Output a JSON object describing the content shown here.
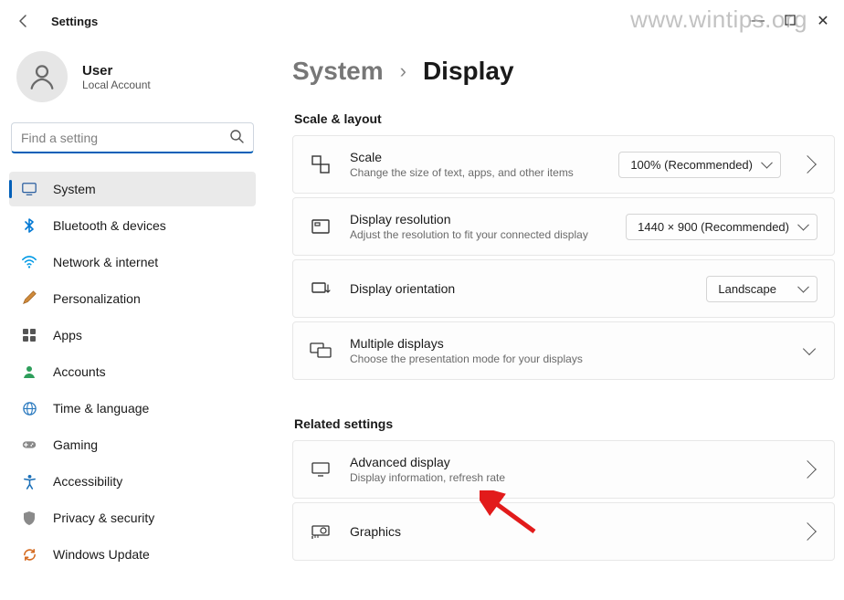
{
  "titlebar": {
    "title": "Settings"
  },
  "watermark": "www.wintips.org",
  "profile": {
    "name": "User",
    "subtitle": "Local Account"
  },
  "search": {
    "placeholder": "Find a setting"
  },
  "sidebar": {
    "items": [
      {
        "label": "System"
      },
      {
        "label": "Bluetooth & devices"
      },
      {
        "label": "Network & internet"
      },
      {
        "label": "Personalization"
      },
      {
        "label": "Apps"
      },
      {
        "label": "Accounts"
      },
      {
        "label": "Time & language"
      },
      {
        "label": "Gaming"
      },
      {
        "label": "Accessibility"
      },
      {
        "label": "Privacy & security"
      },
      {
        "label": "Windows Update"
      }
    ]
  },
  "breadcrumb": {
    "parent": "System",
    "current": "Display"
  },
  "sections": {
    "scale_layout": {
      "heading": "Scale & layout",
      "scale": {
        "title": "Scale",
        "subtitle": "Change the size of text, apps, and other items",
        "value": "100% (Recommended)"
      },
      "resolution": {
        "title": "Display resolution",
        "subtitle": "Adjust the resolution to fit your connected display",
        "value": "1440 × 900 (Recommended)"
      },
      "orientation": {
        "title": "Display orientation",
        "value": "Landscape"
      },
      "multiple": {
        "title": "Multiple displays",
        "subtitle": "Choose the presentation mode for your displays"
      }
    },
    "related": {
      "heading": "Related settings",
      "advanced": {
        "title": "Advanced display",
        "subtitle": "Display information, refresh rate"
      },
      "graphics": {
        "title": "Graphics"
      }
    }
  }
}
